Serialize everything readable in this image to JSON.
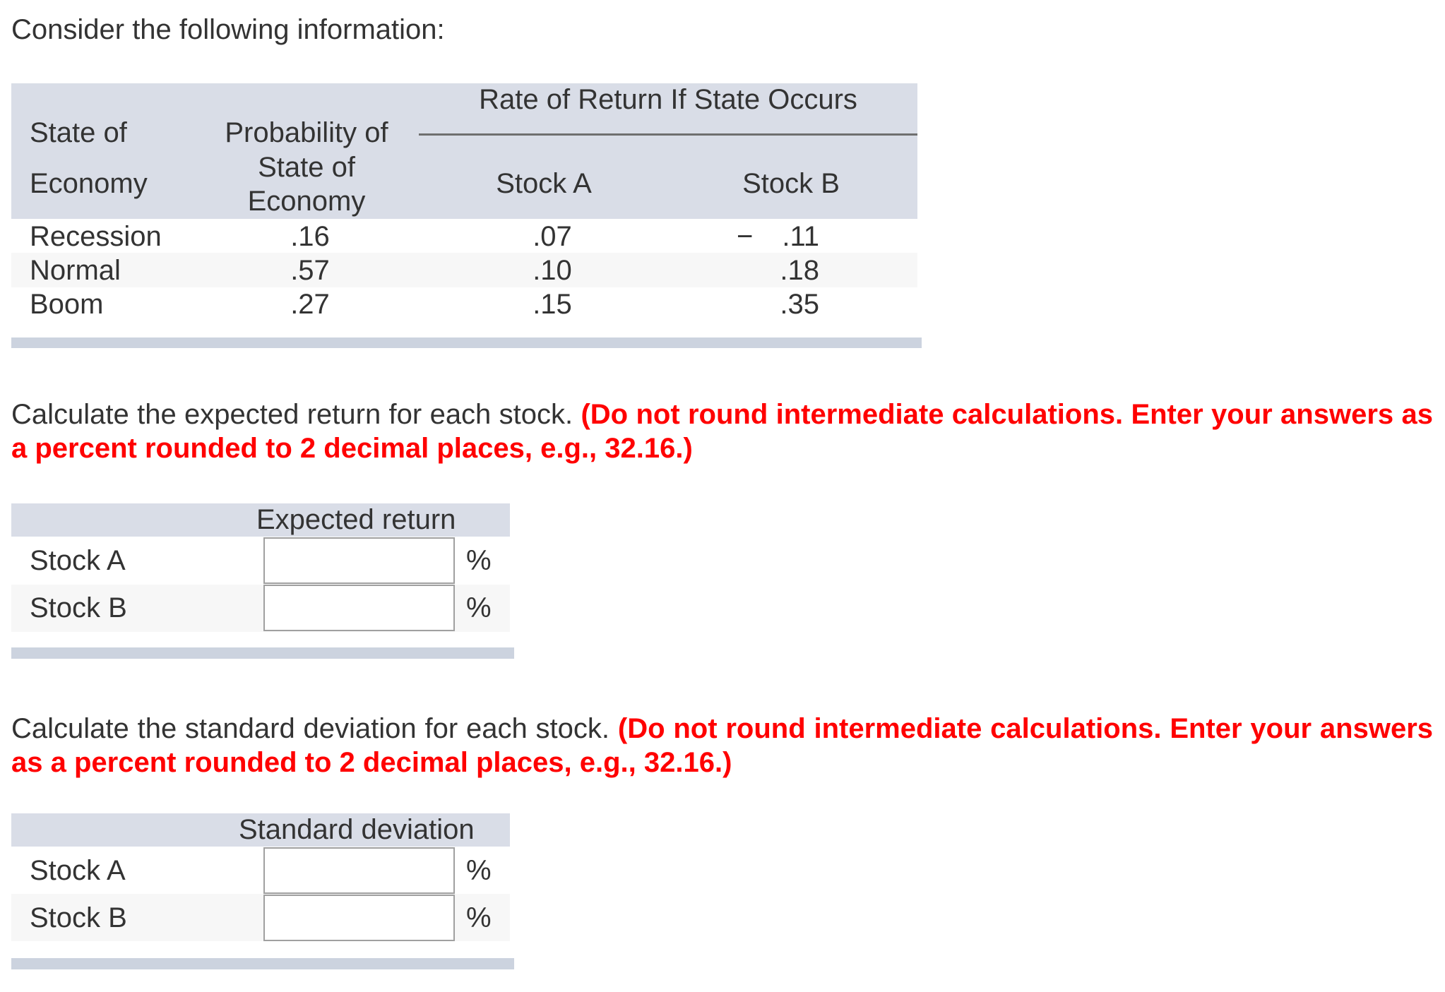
{
  "intro": "Consider the following information:",
  "info_table": {
    "group_header": "Rate of Return If State Occurs",
    "columns": {
      "state_line1": "State of",
      "state_line2": "Economy",
      "prob_line1": "Probability of",
      "prob_line2": "State of",
      "prob_line3": "Economy",
      "stock_a": "Stock A",
      "stock_b": "Stock B"
    },
    "rows": [
      {
        "state": "Recession",
        "probability": ".16",
        "stock_a": ".07",
        "stock_b_sign": "−",
        "stock_b": ".11"
      },
      {
        "state": "Normal",
        "probability": ".57",
        "stock_a": ".10",
        "stock_b_sign": "",
        "stock_b": ".18"
      },
      {
        "state": "Boom",
        "probability": ".27",
        "stock_a": ".15",
        "stock_b_sign": "",
        "stock_b": ".35"
      }
    ]
  },
  "question1": {
    "text": "Calculate the expected return for each stock.",
    "instruction": "(Do not round intermediate calculations. Enter your answers as a percent rounded to 2 decimal places, e.g., 32.16.)"
  },
  "expected_table": {
    "header": "Expected return",
    "rows": [
      {
        "label": "Stock A",
        "value": "",
        "unit": "%"
      },
      {
        "label": "Stock B",
        "value": "",
        "unit": "%"
      }
    ]
  },
  "question2": {
    "text": "Calculate the standard deviation for each stock.",
    "instruction": "(Do not round intermediate calculations. Enter your answers as a percent rounded to 2 decimal places, e.g., 32.16.)"
  },
  "sd_table": {
    "header": "Standard deviation",
    "rows": [
      {
        "label": "Stock A",
        "value": "",
        "unit": "%"
      },
      {
        "label": "Stock B",
        "value": "",
        "unit": "%"
      }
    ]
  },
  "colors": {
    "instruction_red": "#ff0000",
    "header_fill": "#d9dde7",
    "text": "#333333"
  }
}
